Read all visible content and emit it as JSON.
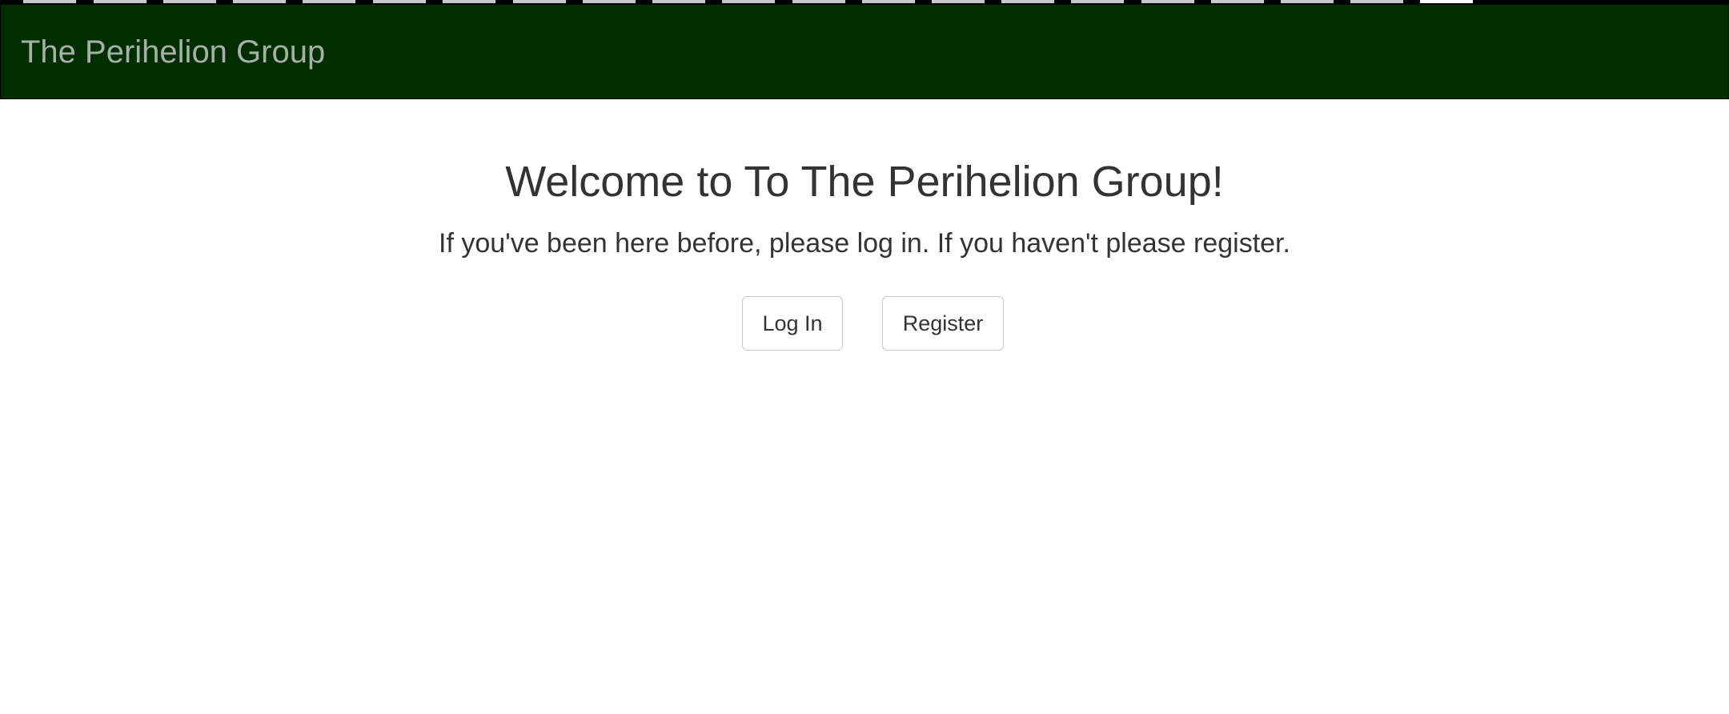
{
  "header": {
    "brand": "The Perihelion Group",
    "background_color": "#002e00",
    "brand_color": "#a6b0a6"
  },
  "welcome": {
    "headline": "Welcome to To The Perihelion Group!",
    "lead": "If you've been here before, please log in. If you haven't please register."
  },
  "actions": {
    "login_label": "Log In",
    "register_label": "Register"
  }
}
